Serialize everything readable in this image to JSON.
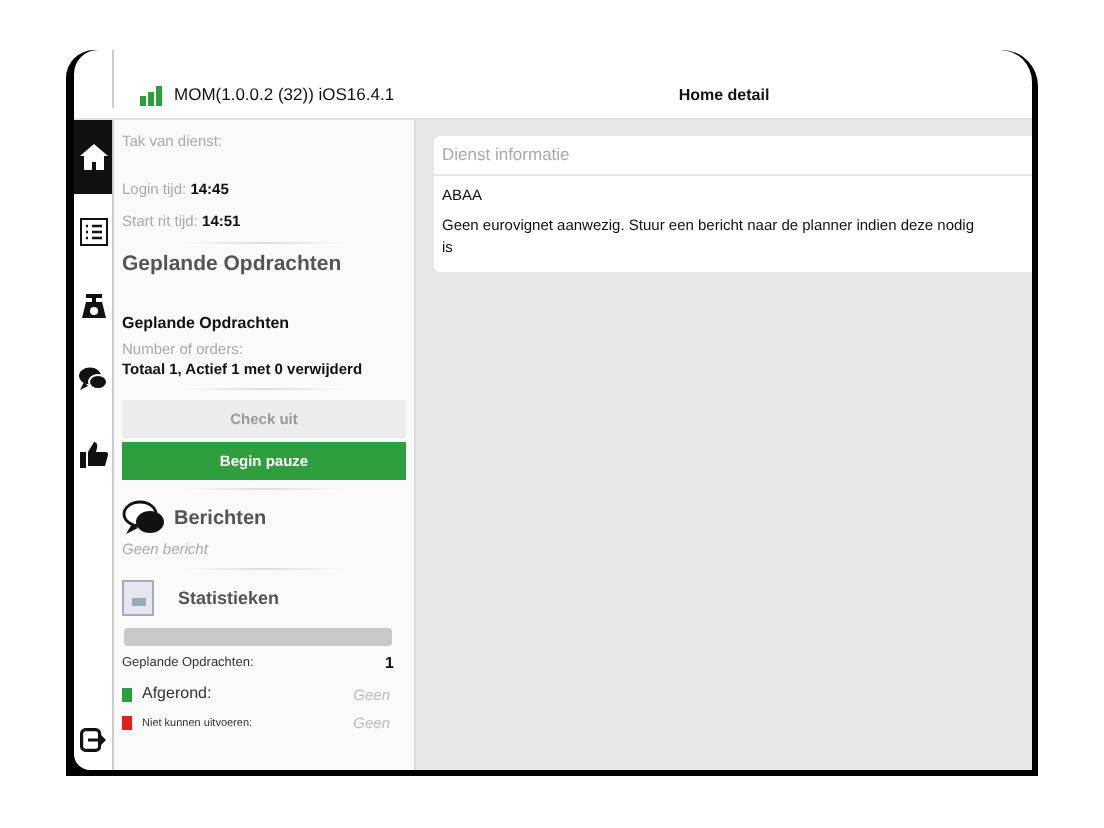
{
  "header": {
    "app_version": "MOM(1.0.0.2 (32)) iOS16.4.1",
    "detail_title": "Home detail"
  },
  "tabs": [
    {
      "kind": "home",
      "selected": true
    },
    {
      "kind": "list",
      "selected": false
    },
    {
      "kind": "scale",
      "selected": false
    },
    {
      "kind": "chat",
      "selected": false
    },
    {
      "kind": "thumb",
      "selected": false
    }
  ],
  "master": {
    "tak_label": "Tak van dienst:",
    "login_label": "Login tijd:",
    "login_value": "14:45",
    "start_label": "Start rit tijd:",
    "start_value": "14:51",
    "planned_heading": "Geplande Opdrachten",
    "planned_subheading": "Geplande Opdrachten",
    "orders_label": "Number of orders:",
    "orders_value": "Totaal 1, Actief 1 met 0 verwijderd",
    "buttons": [
      {
        "label": "Check uit",
        "disabled": true
      },
      {
        "label": "Begin pauze",
        "disabled": false
      }
    ],
    "messages_heading": "Berichten",
    "messages_empty": "Geen bericht",
    "stats_heading": "Statistieken",
    "stats_bar": {
      "level": 0
    },
    "stats_rows": [
      {
        "kind": "total",
        "label": "Geplande Opdrachten:",
        "value": "1"
      },
      {
        "kind": "legend",
        "label": "Afgerond:",
        "value": "Geen",
        "color": "#2e9e3e"
      },
      {
        "kind": "legend",
        "label": "Niet kunnen uitvoeren:",
        "value": "Geen",
        "color": "#e0201b"
      }
    ]
  },
  "detail": {
    "section_title": "Dienst informatie",
    "code": "ABAA",
    "message": "Geen eurovignet aanwezig. Stuur een bericht naar de planner indien deze nodig is"
  }
}
